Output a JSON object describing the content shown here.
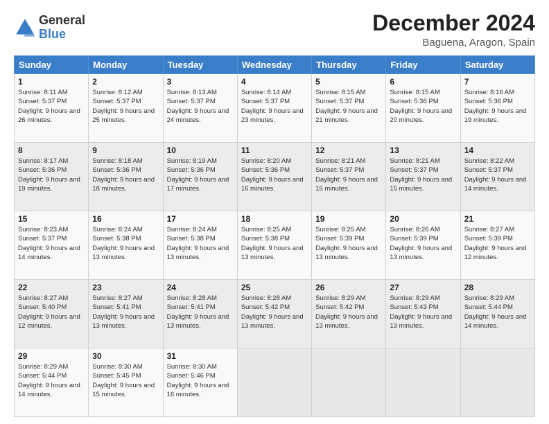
{
  "header": {
    "logo_general": "General",
    "logo_blue": "Blue",
    "month_title": "December 2024",
    "location": "Baguena, Aragon, Spain"
  },
  "days": [
    "Sunday",
    "Monday",
    "Tuesday",
    "Wednesday",
    "Thursday",
    "Friday",
    "Saturday"
  ],
  "weeks": [
    [
      {
        "day": "1",
        "sunrise": "8:11 AM",
        "sunset": "5:37 PM",
        "daylight": "9 hours and 26 minutes."
      },
      {
        "day": "2",
        "sunrise": "8:12 AM",
        "sunset": "5:37 PM",
        "daylight": "9 hours and 25 minutes."
      },
      {
        "day": "3",
        "sunrise": "8:13 AM",
        "sunset": "5:37 PM",
        "daylight": "9 hours and 24 minutes."
      },
      {
        "day": "4",
        "sunrise": "8:14 AM",
        "sunset": "5:37 PM",
        "daylight": "9 hours and 23 minutes."
      },
      {
        "day": "5",
        "sunrise": "8:15 AM",
        "sunset": "5:37 PM",
        "daylight": "9 hours and 21 minutes."
      },
      {
        "day": "6",
        "sunrise": "8:15 AM",
        "sunset": "5:36 PM",
        "daylight": "9 hours and 20 minutes."
      },
      {
        "day": "7",
        "sunrise": "8:16 AM",
        "sunset": "5:36 PM",
        "daylight": "9 hours and 19 minutes."
      }
    ],
    [
      {
        "day": "8",
        "sunrise": "8:17 AM",
        "sunset": "5:36 PM",
        "daylight": "9 hours and 19 minutes."
      },
      {
        "day": "9",
        "sunrise": "8:18 AM",
        "sunset": "5:36 PM",
        "daylight": "9 hours and 18 minutes."
      },
      {
        "day": "10",
        "sunrise": "8:19 AM",
        "sunset": "5:36 PM",
        "daylight": "9 hours and 17 minutes."
      },
      {
        "day": "11",
        "sunrise": "8:20 AM",
        "sunset": "5:36 PM",
        "daylight": "9 hours and 16 minutes."
      },
      {
        "day": "12",
        "sunrise": "8:21 AM",
        "sunset": "5:37 PM",
        "daylight": "9 hours and 15 minutes."
      },
      {
        "day": "13",
        "sunrise": "8:21 AM",
        "sunset": "5:37 PM",
        "daylight": "9 hours and 15 minutes."
      },
      {
        "day": "14",
        "sunrise": "8:22 AM",
        "sunset": "5:37 PM",
        "daylight": "9 hours and 14 minutes."
      }
    ],
    [
      {
        "day": "15",
        "sunrise": "8:23 AM",
        "sunset": "5:37 PM",
        "daylight": "9 hours and 14 minutes."
      },
      {
        "day": "16",
        "sunrise": "8:24 AM",
        "sunset": "5:38 PM",
        "daylight": "9 hours and 13 minutes."
      },
      {
        "day": "17",
        "sunrise": "8:24 AM",
        "sunset": "5:38 PM",
        "daylight": "9 hours and 13 minutes."
      },
      {
        "day": "18",
        "sunrise": "8:25 AM",
        "sunset": "5:38 PM",
        "daylight": "9 hours and 13 minutes."
      },
      {
        "day": "19",
        "sunrise": "8:25 AM",
        "sunset": "5:39 PM",
        "daylight": "9 hours and 13 minutes."
      },
      {
        "day": "20",
        "sunrise": "8:26 AM",
        "sunset": "5:39 PM",
        "daylight": "9 hours and 13 minutes."
      },
      {
        "day": "21",
        "sunrise": "8:27 AM",
        "sunset": "5:39 PM",
        "daylight": "9 hours and 12 minutes."
      }
    ],
    [
      {
        "day": "22",
        "sunrise": "8:27 AM",
        "sunset": "5:40 PM",
        "daylight": "9 hours and 12 minutes."
      },
      {
        "day": "23",
        "sunrise": "8:27 AM",
        "sunset": "5:41 PM",
        "daylight": "9 hours and 13 minutes."
      },
      {
        "day": "24",
        "sunrise": "8:28 AM",
        "sunset": "5:41 PM",
        "daylight": "9 hours and 13 minutes."
      },
      {
        "day": "25",
        "sunrise": "8:28 AM",
        "sunset": "5:42 PM",
        "daylight": "9 hours and 13 minutes."
      },
      {
        "day": "26",
        "sunrise": "8:29 AM",
        "sunset": "5:42 PM",
        "daylight": "9 hours and 13 minutes."
      },
      {
        "day": "27",
        "sunrise": "8:29 AM",
        "sunset": "5:43 PM",
        "daylight": "9 hours and 13 minutes."
      },
      {
        "day": "28",
        "sunrise": "8:29 AM",
        "sunset": "5:44 PM",
        "daylight": "9 hours and 14 minutes."
      }
    ],
    [
      {
        "day": "29",
        "sunrise": "8:29 AM",
        "sunset": "5:44 PM",
        "daylight": "9 hours and 14 minutes."
      },
      {
        "day": "30",
        "sunrise": "8:30 AM",
        "sunset": "5:45 PM",
        "daylight": "9 hours and 15 minutes."
      },
      {
        "day": "31",
        "sunrise": "8:30 AM",
        "sunset": "5:46 PM",
        "daylight": "9 hours and 16 minutes."
      },
      null,
      null,
      null,
      null
    ]
  ]
}
